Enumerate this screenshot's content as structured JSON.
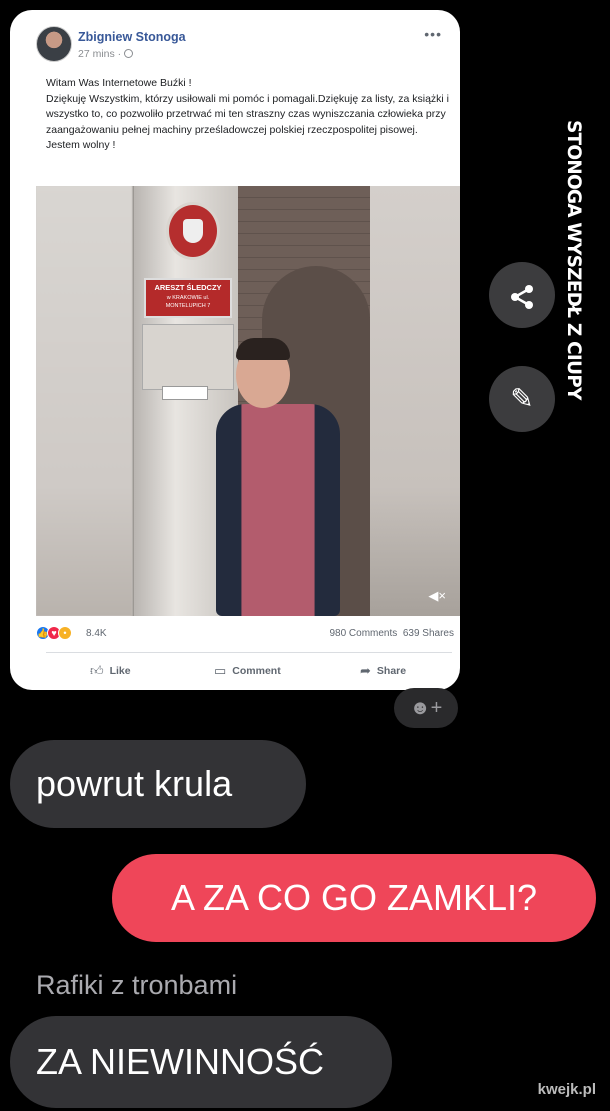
{
  "post": {
    "author": "Zbigniew Stonoga",
    "time": "27 mins ·",
    "text": "Witam Was Internetowe Buźki !\nDziękuję Wszystkim, którzy usiłowali mi pomóc i pomagali.Dziękuję za listy, za książki i wszystko to, co pozwoliło przetrwać mi ten straszny czas wyniszczania człowieka przy zaangażowaniu pełnej machiny prześladowczej polskiej rzeczpospolitej pisowej.\nJestem wolny !",
    "photo_sign": "ARESZT ŚLEDCZY",
    "photo_sign_sub": "w KRAKOWIE ul. MONTELUPICH 7",
    "reaction_count": "8.4K",
    "comments": "980 Comments",
    "shares": "639 Shares",
    "actions": {
      "like": "Like",
      "comment": "Comment",
      "share": "Share"
    }
  },
  "overlay": {
    "side_title": "STONOGA WYSZEDŁ Z CIUPY",
    "share_icon": "share-icon",
    "edit_icon": "pencil-icon",
    "add_reaction_icon": "add-reaction-icon"
  },
  "chat": {
    "messages": [
      {
        "text": "powrut krula",
        "direction": "incoming"
      },
      {
        "text": "A ZA CO GO ZAMKLI?",
        "direction": "outgoing"
      },
      {
        "text": "ZA NIEWINNOŚĆ",
        "direction": "incoming",
        "sender": "Rafiki z tronbami"
      }
    ]
  },
  "watermark": "kwejk.pl",
  "colors": {
    "outgoing_bubble": "#ef4659",
    "incoming_bubble": "#333336",
    "fb_link": "#385898"
  }
}
